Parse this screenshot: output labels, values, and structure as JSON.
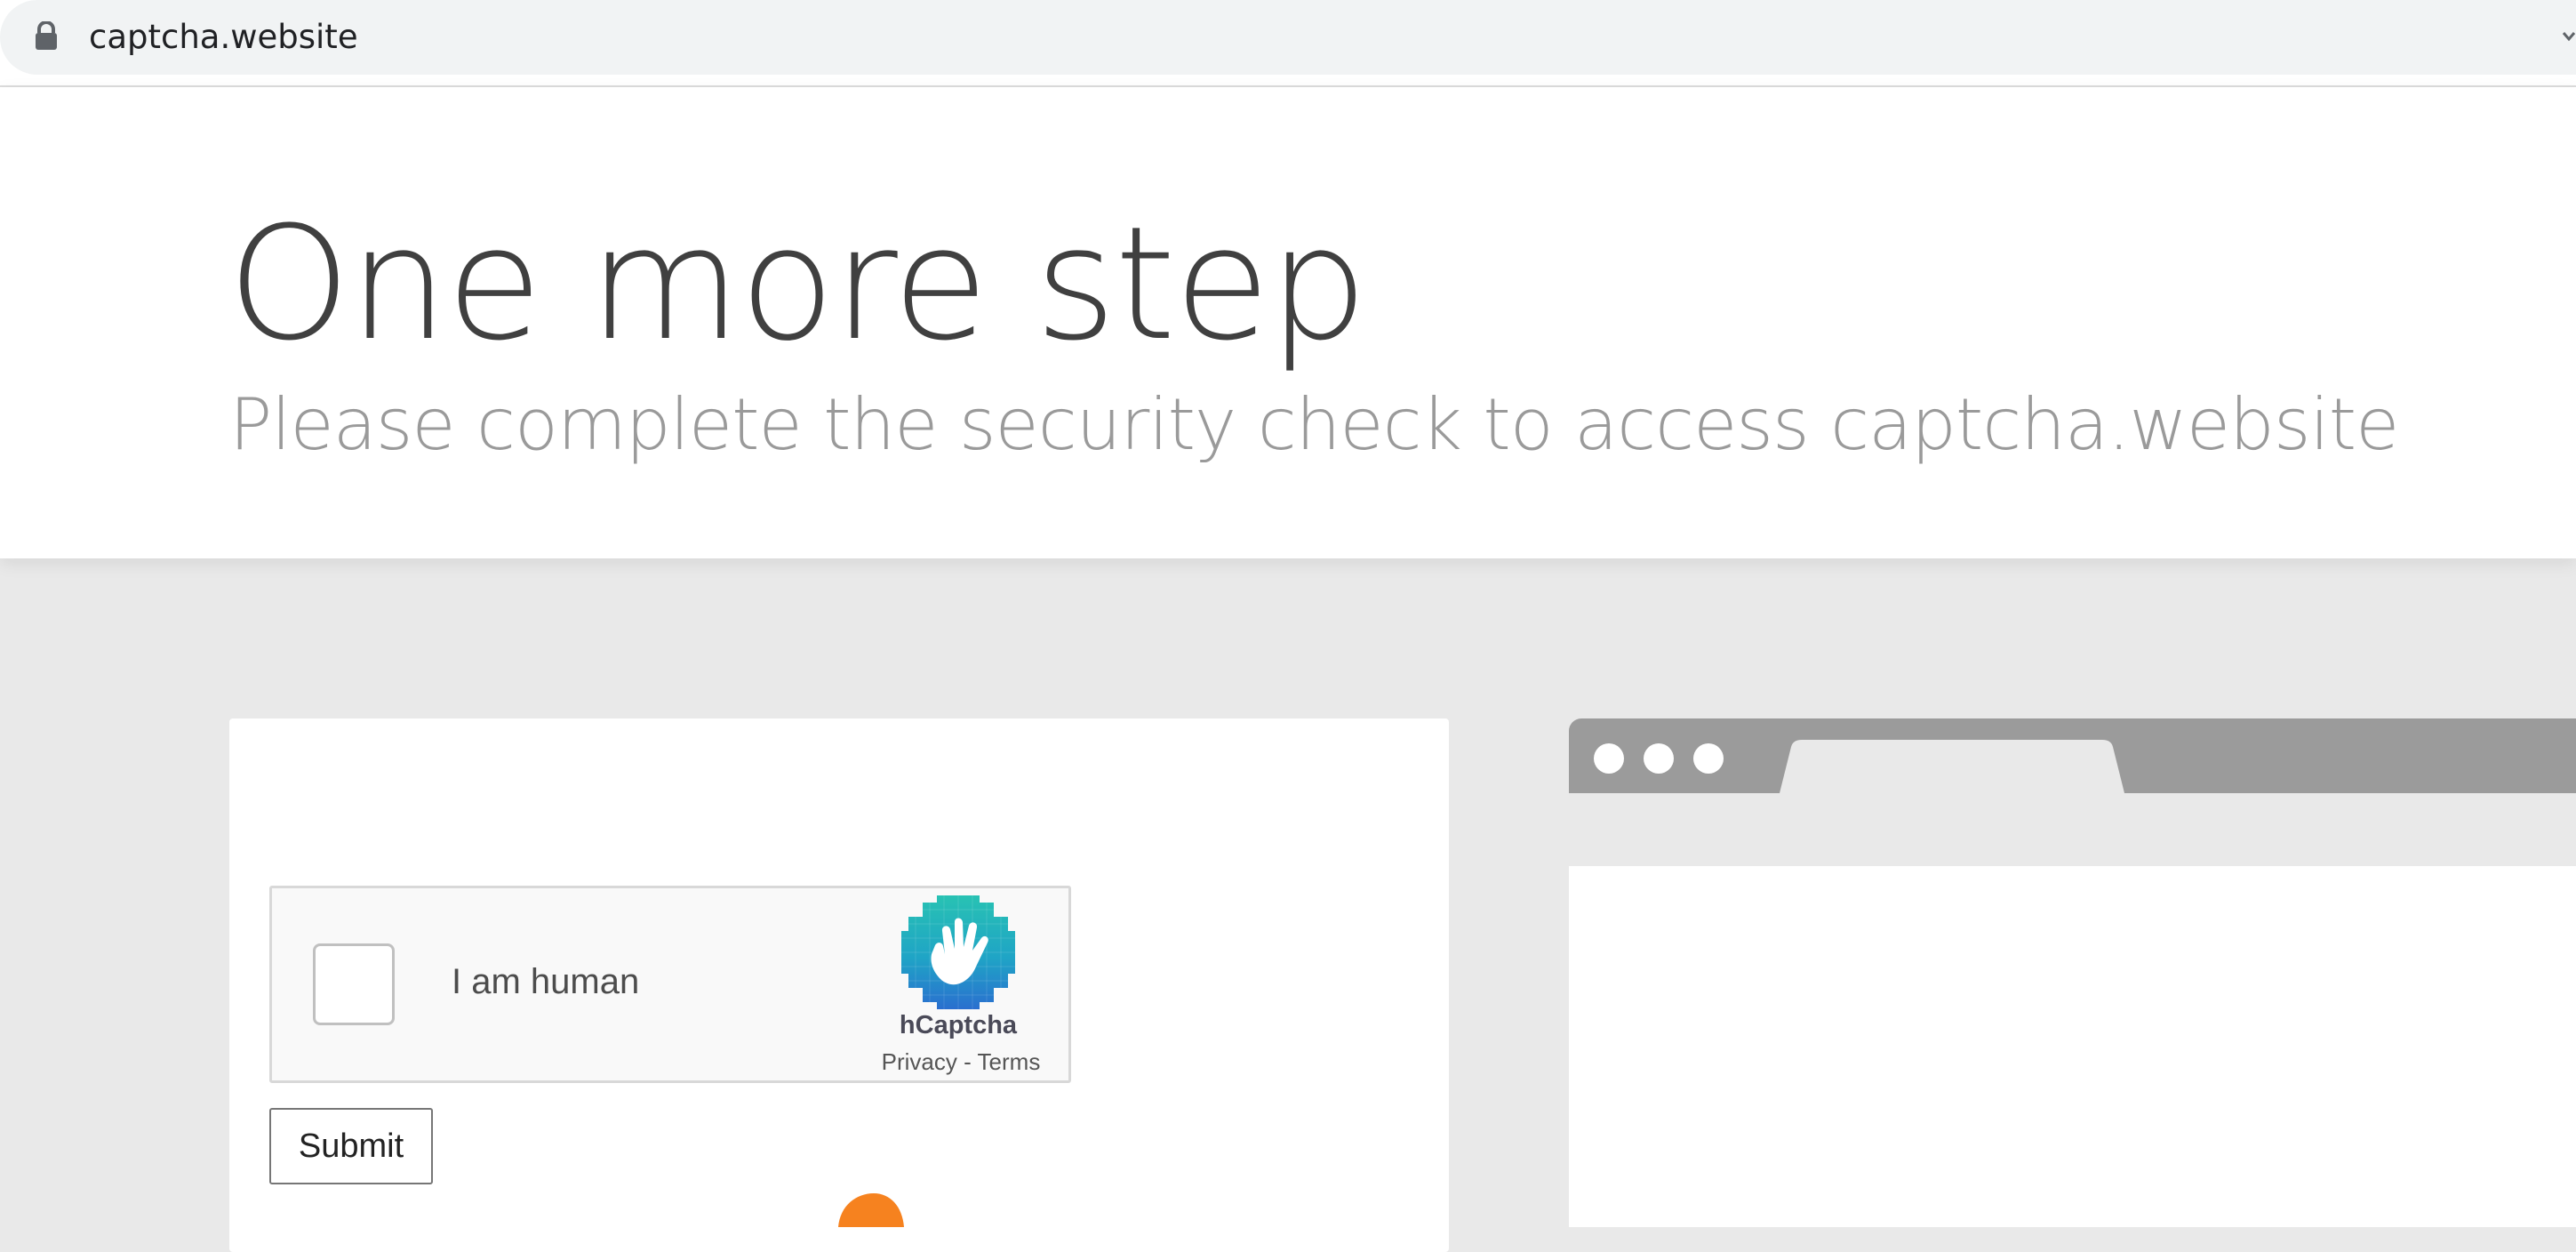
{
  "browser": {
    "url": "captcha.website",
    "icons": {
      "lock": "lock-icon",
      "menu": "chevron-down-icon"
    }
  },
  "header": {
    "title": "One more step",
    "subtitle": "Please complete the security check to access captcha.website"
  },
  "captcha": {
    "checkbox_label": "I am human",
    "brand": "hCaptcha",
    "privacy_link": "Privacy",
    "separator": " - ",
    "terms_link": "Terms",
    "icon": "hcaptcha-hand-icon"
  },
  "form": {
    "submit_label": "Submit"
  },
  "colors": {
    "page_background": "#e9e9e9",
    "title": "#404040",
    "subtitle": "#9a9a9a",
    "illustration_bar": "#9b9b9b",
    "accent_orange": "#f6821f"
  }
}
